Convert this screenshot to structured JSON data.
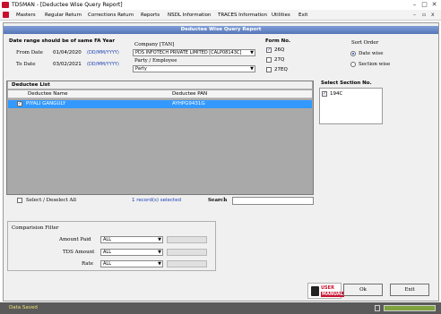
{
  "window": {
    "title": "TDSMAN - [Deductee Wise Query Report]",
    "minimize": "–",
    "maximize": "□",
    "close": "✕"
  },
  "menu": {
    "items": [
      "Masters",
      "Regular Return",
      "Corrections Return",
      "Reports",
      "NSDL Information",
      "TRACES Information",
      "Utilities",
      "Exit"
    ],
    "mdi_min": "–",
    "mdi_max": "▫",
    "mdi_close": "x"
  },
  "header": {
    "title": "Deductee Wise Query Report"
  },
  "date_range": {
    "note": "Date range should be of same FA Year",
    "from_label": "From Date",
    "from_value": "01/04/2020",
    "from_hint": "(DD/MM/YYYY)",
    "to_label": "To Date",
    "to_value": "03/02/2021",
    "to_hint": "(DD/MM/YYYY)"
  },
  "company": {
    "label": "Company [TAN]",
    "value": "PDS INFOTECH PRIVATE LIMITED [CALP08143C]"
  },
  "party": {
    "label": "Party / Employee",
    "value": "Party"
  },
  "form_no": {
    "label": "Form No.",
    "options": [
      {
        "label": "26Q",
        "checked": true
      },
      {
        "label": "27Q",
        "checked": false
      },
      {
        "label": "27EQ",
        "checked": false
      }
    ]
  },
  "sort_order": {
    "label": "Sort Order",
    "options": [
      {
        "label": "Date wise",
        "selected": true
      },
      {
        "label": "Section wise",
        "selected": false
      }
    ]
  },
  "deductee_list": {
    "title": "Deductee List",
    "columns": [
      "Deductee Name",
      "Deductee PAN"
    ],
    "rows": [
      {
        "name": "PIYALI GANGULY",
        "pan": "AYHPG9431G",
        "checked": true
      }
    ]
  },
  "section": {
    "label": "Select Section No.",
    "items": [
      {
        "label": "194C",
        "checked": true
      }
    ]
  },
  "list_footer": {
    "select_all_label": "Select / Deselect All",
    "records_text": "1 record(s) selected",
    "search_label": "Search",
    "search_value": ""
  },
  "comparison": {
    "title": "Comparision Filter",
    "filters": [
      {
        "label": "Amount Paid",
        "value": "ALL"
      },
      {
        "label": "TDS Amount",
        "value": "ALL"
      },
      {
        "label": "Rate",
        "value": "ALL"
      }
    ]
  },
  "buttons": {
    "user_manual_top": "USER",
    "user_manual_bottom": "MANUAL",
    "ok": "Ok",
    "exit": "Exit"
  },
  "status": {
    "text": "Data Saved"
  },
  "colors": {
    "header": "#5676b6",
    "selected_row": "#3399ff",
    "statusbar": "#5a5a5a",
    "accent_text": "#1a3fb2"
  }
}
